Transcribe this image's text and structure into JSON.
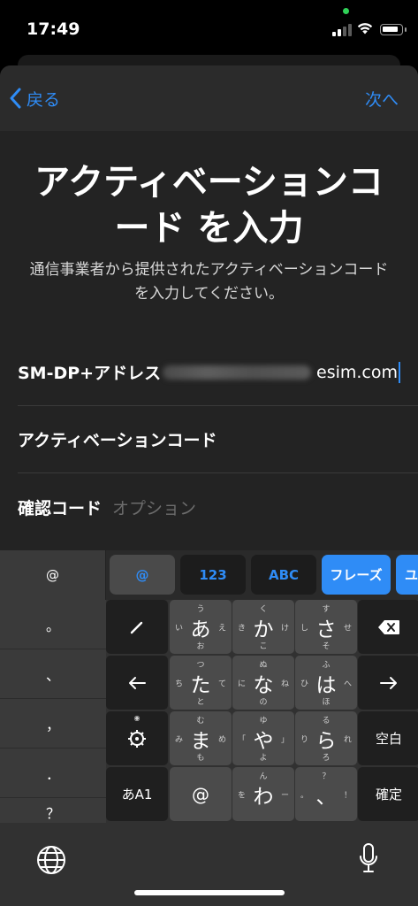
{
  "status": {
    "time": "17:49"
  },
  "nav": {
    "back_label": "戻る",
    "next_label": "次へ"
  },
  "title": "アクティベーションコード を入力",
  "subtitle": "通信事業者から提供されたアクティベーションコードを入力してください。",
  "fields": {
    "smdp_label": "SM-DP+アドレス",
    "smdp_value_suffix": "esim.com",
    "activation_label": "アクティベーションコード",
    "confirm_label": "確認コード",
    "confirm_placeholder": "オプション"
  },
  "keyboard": {
    "candidates": {
      "left": "@",
      "at": "@",
      "num": "123",
      "abc": "ABC",
      "phrase": "フレーズ",
      "next": "ユ"
    },
    "left_col": [
      "。",
      "、",
      "，",
      "．",
      "？"
    ],
    "rows": [
      {
        "main": "あ",
        "t": "う",
        "b": "お",
        "l": "い",
        "r": "え"
      },
      {
        "main": "か",
        "t": "く",
        "b": "こ",
        "l": "き",
        "r": "け"
      },
      {
        "main": "さ",
        "t": "す",
        "b": "そ",
        "l": "し",
        "r": "せ"
      },
      {
        "main": "た",
        "t": "つ",
        "b": "と",
        "l": "ち",
        "r": "て"
      },
      {
        "main": "な",
        "t": "ぬ",
        "b": "の",
        "l": "に",
        "r": "ね"
      },
      {
        "main": "は",
        "t": "ふ",
        "b": "ほ",
        "l": "ひ",
        "r": "へ"
      },
      {
        "main": "ま",
        "t": "む",
        "b": "も",
        "l": "み",
        "r": "め"
      },
      {
        "main": "や",
        "t": "ゆ",
        "b": "よ",
        "l": "「",
        "r": "」"
      },
      {
        "main": "ら",
        "t": "る",
        "b": "ろ",
        "l": "り",
        "r": "れ"
      },
      {
        "main": "わ",
        "t": "ん",
        "b": "",
        "l": "を",
        "r": "ー"
      }
    ],
    "punct_key": {
      "main": "、",
      "t": "？",
      "l": "。",
      "r": "！"
    },
    "kana_switch": "あA1",
    "at_key": "@",
    "space_label": "空白",
    "enter_label": "確定"
  }
}
